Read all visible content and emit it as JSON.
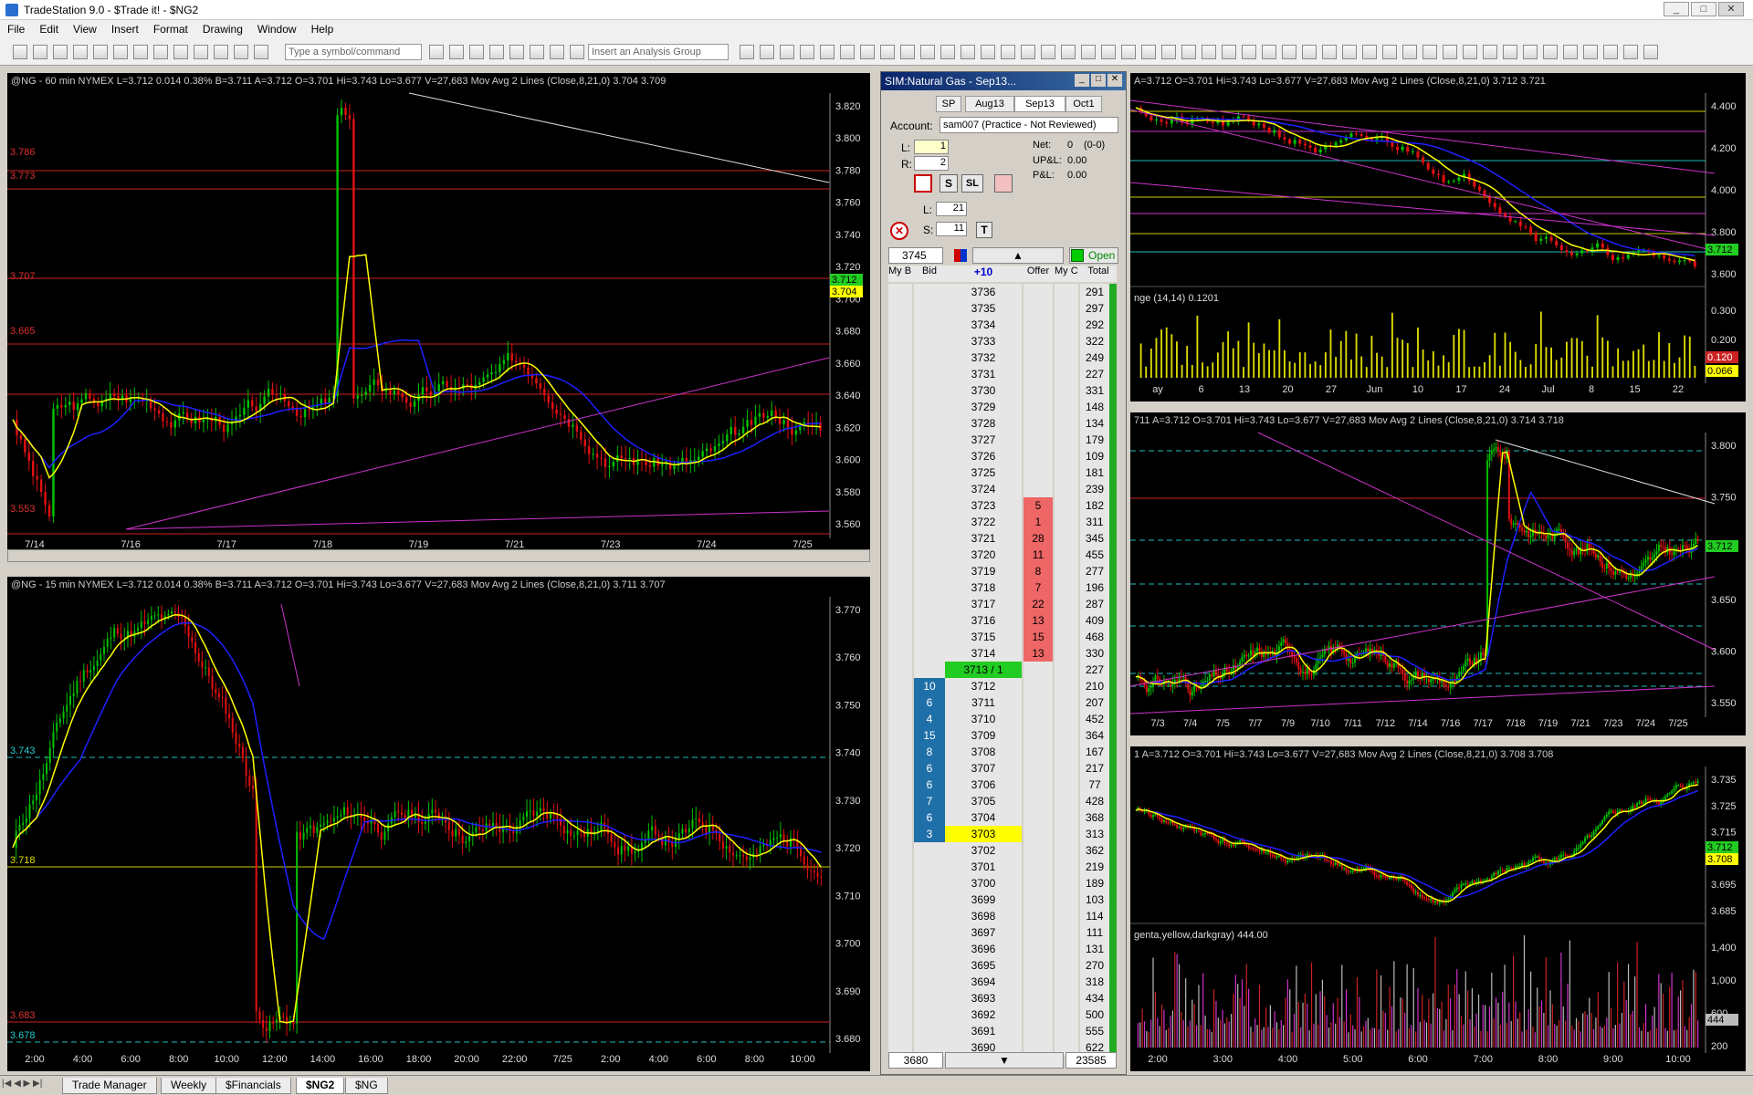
{
  "app": {
    "title": "TradeStation 9.0 - $Trade it! - $NG2"
  },
  "menu": [
    "File",
    "Edit",
    "View",
    "Insert",
    "Format",
    "Drawing",
    "Window",
    "Help"
  ],
  "toolbar": {
    "symbol_placeholder": "Type a symbol/command",
    "analysis_placeholder": "Insert an Analysis Group"
  },
  "colors": {
    "up": "#00c000",
    "down": "#e01010",
    "ma_fast": "#ffff00",
    "ma_slow": "#2020ff",
    "trend": "#cc33cc"
  },
  "chart1": {
    "status": "@NG - 60 min  NYMEX  L=3.712  0.014  0.38%  B=3.711  A=3.712  O=3.701  Hi=3.743  Lo=3.677  V=27,683  Mov Avg 2 Lines (Close,8,21,0)  3.704  3.709",
    "yticks": [
      "3.820",
      "3.800",
      "3.780",
      "3.760",
      "3.740",
      "3.720",
      "3.700",
      "3.680",
      "3.660",
      "3.640",
      "3.620",
      "3.600",
      "3.580",
      "3.560"
    ],
    "xticks": [
      "7/14",
      "7/16",
      "7/17",
      "7/18",
      "7/19",
      "7/21",
      "7/23",
      "7/24",
      "7/25"
    ],
    "levels": [
      "3.786",
      "3.773",
      "3.707",
      "3.665",
      "3.553"
    ],
    "last": [
      "3.712",
      "3.704"
    ]
  },
  "chart2": {
    "status": "@NG - 15 min  NYMEX  L=3.712  0.014  0.38%  B=3.711  A=3.712  O=3.701  Hi=3.743  Lo=3.677  V=27,683  Mov Avg 2 Lines (Close,8,21,0)  3.711  3.707",
    "yticks": [
      "3.770",
      "3.760",
      "3.750",
      "3.740",
      "3.730",
      "3.720",
      "3.710",
      "3.700",
      "3.690",
      "3.680"
    ],
    "xticks": [
      "2:00",
      "4:00",
      "6:00",
      "8:00",
      "10:00",
      "12:00",
      "14:00",
      "16:00",
      "18:00",
      "20:00",
      "22:00",
      "7/25",
      "2:00",
      "4:00",
      "6:00",
      "8:00",
      "10:00"
    ],
    "levels": [
      "3.743",
      "3.718",
      "3.683",
      "3.678"
    ]
  },
  "chart3": {
    "status": "A=3.712  O=3.701  Hi=3.743  Lo=3.677  V=27,683  Mov Avg 2 Lines (Close,8,21,0)  3.712  3.721",
    "yticks": [
      "4.400",
      "4.200",
      "4.000",
      "3.800",
      "3.600"
    ],
    "xticks": [
      "ay",
      "6",
      "13",
      "20",
      "27",
      "Jun",
      "10",
      "17",
      "24",
      "Jul",
      "8",
      "15",
      "22"
    ],
    "sub_label": "nge (14,14)  0.1201",
    "sub_yticks": [
      "0.300",
      "0.200"
    ],
    "last": "3.712",
    "sub_last": [
      "0.120",
      "0.066"
    ]
  },
  "chart4": {
    "status": "711  A=3.712  O=3.701  Hi=3.743  Lo=3.677  V=27,683  Mov Avg 2 Lines (Close,8,21,0)  3.714  3.718",
    "yticks": [
      "3.800",
      "3.750",
      "3.700",
      "3.650",
      "3.600",
      "3.550"
    ],
    "xticks": [
      "7/3",
      "7/4",
      "7/5",
      "7/7",
      "7/9",
      "7/10",
      "7/11",
      "7/12",
      "7/14",
      "7/16",
      "7/17",
      "7/18",
      "7/19",
      "7/21",
      "7/23",
      "7/24",
      "7/25"
    ],
    "last": "3.712"
  },
  "chart5": {
    "status": "1  A=3.712  O=3.701  Hi=3.743  Lo=3.677  V=27,683  Mov Avg 2 Lines (Close,8,21,0)  3.708  3.708",
    "yticks": [
      "3.735",
      "3.725",
      "3.715",
      "3.705",
      "3.695",
      "3.685"
    ],
    "xticks": [
      "2:00",
      "3:00",
      "4:00",
      "5:00",
      "6:00",
      "7:00",
      "8:00",
      "9:00",
      "10:00"
    ],
    "sub_label": "genta,yellow,darkgray)  444.00",
    "sub_yticks": [
      "1,400",
      "1,000",
      "600",
      "200"
    ],
    "last": [
      "3.712",
      "3.708"
    ],
    "sub_last": "444"
  },
  "ladder": {
    "title": "SIM:Natural Gas - Sep13...",
    "tabs": [
      "SP",
      "Aug13",
      "Sep13",
      "Oct1"
    ],
    "account_label": "Account:",
    "account": "sam007 (Practice - Not Reviewed)",
    "l_label": "L:",
    "l_val": "1",
    "r_label": "R:",
    "r_val": "2",
    "net_label": "Net:",
    "net": "0",
    "net_detail": "(0-0)",
    "upl_label": "UP&L:",
    "upl": "0.00",
    "pl_label": "P&L:",
    "pl": "0.00",
    "l2_label": "L:",
    "l2_val": "21",
    "s_label": "S:",
    "s_val": "11",
    "s_btn": "S",
    "sl_btn": "SL",
    "t_btn": "T",
    "price_box": "3745",
    "open_label": "Open",
    "headers": [
      "My B",
      "Bid",
      "+10",
      "Offer",
      "My C",
      "Total"
    ],
    "footer_price": "3680",
    "footer_total": "23585",
    "rows": [
      {
        "p": "3736",
        "t": "291"
      },
      {
        "p": "3735",
        "t": "297"
      },
      {
        "p": "3734",
        "t": "292"
      },
      {
        "p": "3733",
        "t": "322"
      },
      {
        "p": "3732",
        "t": "249"
      },
      {
        "p": "3731",
        "t": "227"
      },
      {
        "p": "3730",
        "t": "331"
      },
      {
        "p": "3729",
        "t": "148"
      },
      {
        "p": "3728",
        "t": "134"
      },
      {
        "p": "3727",
        "t": "179"
      },
      {
        "p": "3726",
        "t": "109"
      },
      {
        "p": "3725",
        "t": "181"
      },
      {
        "p": "3724",
        "t": "239"
      },
      {
        "p": "3723",
        "o": "5",
        "t": "182"
      },
      {
        "p": "3722",
        "o": "1",
        "t": "311"
      },
      {
        "p": "3721",
        "o": "28",
        "t": "345"
      },
      {
        "p": "3720",
        "o": "11",
        "t": "455"
      },
      {
        "p": "3719",
        "o": "8",
        "t": "277"
      },
      {
        "p": "3718",
        "o": "7",
        "t": "196"
      },
      {
        "p": "3717",
        "o": "22",
        "t": "287"
      },
      {
        "p": "3716",
        "o": "13",
        "t": "409"
      },
      {
        "p": "3715",
        "o": "15",
        "t": "468"
      },
      {
        "p": "3714",
        "o": "13",
        "t": "330"
      },
      {
        "p": "3713 / 1",
        "last": true,
        "t": "227"
      },
      {
        "p": "3712",
        "b": "10",
        "t": "210"
      },
      {
        "p": "3711",
        "b": "6",
        "t": "207"
      },
      {
        "p": "3710",
        "b": "4",
        "t": "452"
      },
      {
        "p": "3709",
        "b": "15",
        "t": "364"
      },
      {
        "p": "3708",
        "b": "8",
        "t": "167"
      },
      {
        "p": "3707",
        "b": "6",
        "t": "217"
      },
      {
        "p": "3706",
        "b": "6",
        "t": "77"
      },
      {
        "p": "3705",
        "b": "7",
        "t": "428"
      },
      {
        "p": "3704",
        "b": "6",
        "t": "368"
      },
      {
        "p": "3703",
        "b": "3",
        "hi": true,
        "t": "313"
      },
      {
        "p": "3702",
        "t": "362"
      },
      {
        "p": "3701",
        "t": "219"
      },
      {
        "p": "3700",
        "t": "189"
      },
      {
        "p": "3699",
        "t": "103"
      },
      {
        "p": "3698",
        "t": "114"
      },
      {
        "p": "3697",
        "t": "111"
      },
      {
        "p": "3696",
        "t": "131"
      },
      {
        "p": "3695",
        "t": "270"
      },
      {
        "p": "3694",
        "t": "318"
      },
      {
        "p": "3693",
        "t": "434"
      },
      {
        "p": "3692",
        "t": "500"
      },
      {
        "p": "3691",
        "t": "555"
      },
      {
        "p": "3690",
        "t": "622"
      }
    ]
  },
  "bottom_tabs": [
    "Trade Manager",
    "Weekly",
    "$Financials",
    "$NG2",
    "$NG"
  ]
}
